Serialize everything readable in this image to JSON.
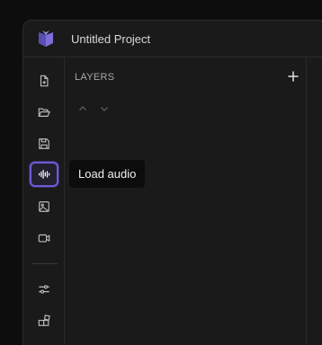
{
  "header": {
    "project_title": "Untitled Project",
    "logo_icon": "cube-logo-icon"
  },
  "toolbar": {
    "tools": [
      {
        "name": "new-file",
        "icon": "file-plus-icon"
      },
      {
        "name": "open-folder",
        "icon": "folder-open-icon"
      },
      {
        "name": "save",
        "icon": "save-icon"
      },
      {
        "name": "load-audio",
        "icon": "audio-waveform-icon",
        "active": true
      },
      {
        "name": "load-image",
        "icon": "image-icon"
      },
      {
        "name": "load-video",
        "icon": "video-icon"
      },
      {
        "name": "settings",
        "icon": "sliders-icon"
      },
      {
        "name": "plugins",
        "icon": "blocks-icon"
      }
    ],
    "active_color": "#6d5bd6"
  },
  "layers": {
    "title": "LAYERS",
    "add_icon": "plus-icon",
    "move_up_icon": "chevron-up-icon",
    "move_down_icon": "chevron-down-icon"
  },
  "tooltip": {
    "text": "Load audio"
  }
}
